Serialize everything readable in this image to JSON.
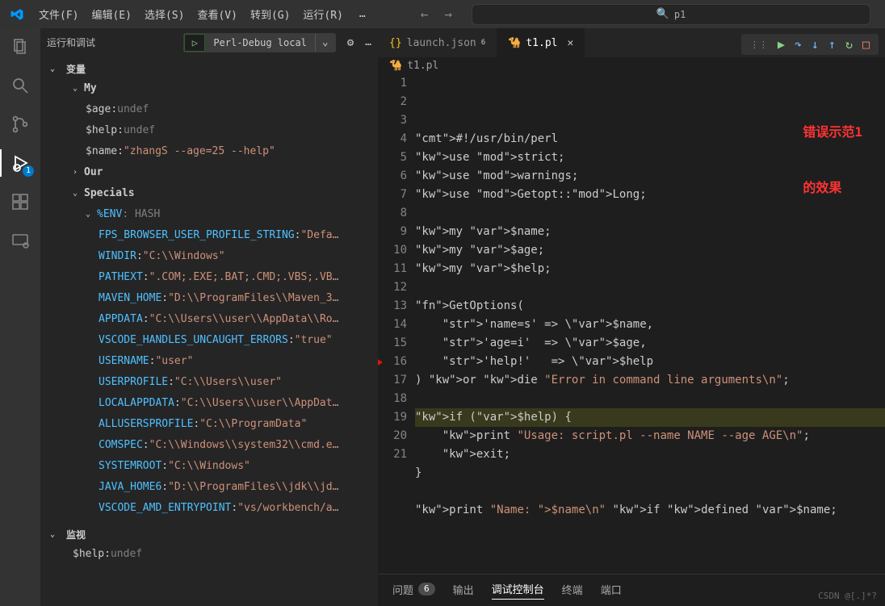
{
  "menubar": {
    "items": [
      "文件(F)",
      "编辑(E)",
      "选择(S)",
      "查看(V)",
      "转到(G)",
      "运行(R)"
    ],
    "more": "…"
  },
  "search": {
    "placeholder": "p1"
  },
  "activity": {
    "debug_badge": "1"
  },
  "side": {
    "title": "运行和调试",
    "config": "Perl-Debug local",
    "sections": {
      "variables": "变量",
      "watch": "监视",
      "my": "My",
      "our": "Our",
      "specials": "Specials",
      "env": "%ENV",
      "env_type": ": HASH"
    },
    "my_vars": [
      {
        "name": "$age",
        "value": "undef",
        "undef": true
      },
      {
        "name": "$help",
        "value": "undef",
        "undef": true
      },
      {
        "name": "$name",
        "value": "\"zhangS --age=25 --help\"",
        "undef": false
      }
    ],
    "env_vars": [
      {
        "k": "FPS_BROWSER_USER_PROFILE_STRING",
        "v": "\"Defa…"
      },
      {
        "k": "WINDIR",
        "v": "\"C:\\\\Windows\""
      },
      {
        "k": "PATHEXT",
        "v": "\".COM;.EXE;.BAT;.CMD;.VBS;.VB…"
      },
      {
        "k": "MAVEN_HOME",
        "v": "\"D:\\\\ProgramFiles\\\\Maven_3…"
      },
      {
        "k": "APPDATA",
        "v": "\"C:\\\\Users\\\\user\\\\AppData\\\\Ro…"
      },
      {
        "k": "VSCODE_HANDLES_UNCAUGHT_ERRORS",
        "v": "\"true\""
      },
      {
        "k": "USERNAME",
        "v": "\"user\""
      },
      {
        "k": "USERPROFILE",
        "v": "\"C:\\\\Users\\\\user\""
      },
      {
        "k": "LOCALAPPDATA",
        "v": "\"C:\\\\Users\\\\user\\\\AppDat…"
      },
      {
        "k": "ALLUSERSPROFILE",
        "v": "\"C:\\\\ProgramData\""
      },
      {
        "k": "COMSPEC",
        "v": "\"C:\\\\Windows\\\\system32\\\\cmd.e…"
      },
      {
        "k": "SYSTEMROOT",
        "v": "\"C:\\\\Windows\""
      },
      {
        "k": "JAVA_HOME6",
        "v": "\"D:\\\\ProgramFiles\\\\jdk\\\\jd…"
      },
      {
        "k": "VSCODE_AMD_ENTRYPOINT",
        "v": "\"vs/workbench/a…"
      }
    ],
    "watch_items": [
      {
        "name": "$help",
        "value": "undef",
        "undef": true
      }
    ]
  },
  "tabs": [
    {
      "label": "launch.json",
      "mod": "6",
      "active": false,
      "type": "json"
    },
    {
      "label": "t1.pl",
      "active": true,
      "type": "pl"
    }
  ],
  "breadcrumb": "t1.pl",
  "annotation": {
    "line1": "错误示范1",
    "line2": "的效果"
  },
  "code": {
    "lines": [
      "#!/usr/bin/perl",
      "use strict;",
      "use warnings;",
      "use Getopt::Long;",
      "",
      "my $name;",
      "my $age;",
      "my $help;",
      "",
      "GetOptions(",
      "    'name=s' => \\$name,",
      "    'age=i'  => \\$age,",
      "    'help!'   => \\$help",
      ") or die \"Error in command line arguments\\n\";",
      "",
      "if ($help) {",
      "    print \"Usage: script.pl --name NAME --age AGE\\n\";",
      "    exit;",
      "}",
      "",
      "print \"Name: $name\\n\" if defined $name;"
    ],
    "current_line": 16
  },
  "bottom_panel": {
    "tabs": [
      {
        "label": "问题",
        "badge": "6"
      },
      {
        "label": "输出"
      },
      {
        "label": "调试控制台",
        "active": true
      },
      {
        "label": "终端"
      },
      {
        "label": "端口"
      }
    ]
  },
  "watermark": "CSDN @[.]*?"
}
